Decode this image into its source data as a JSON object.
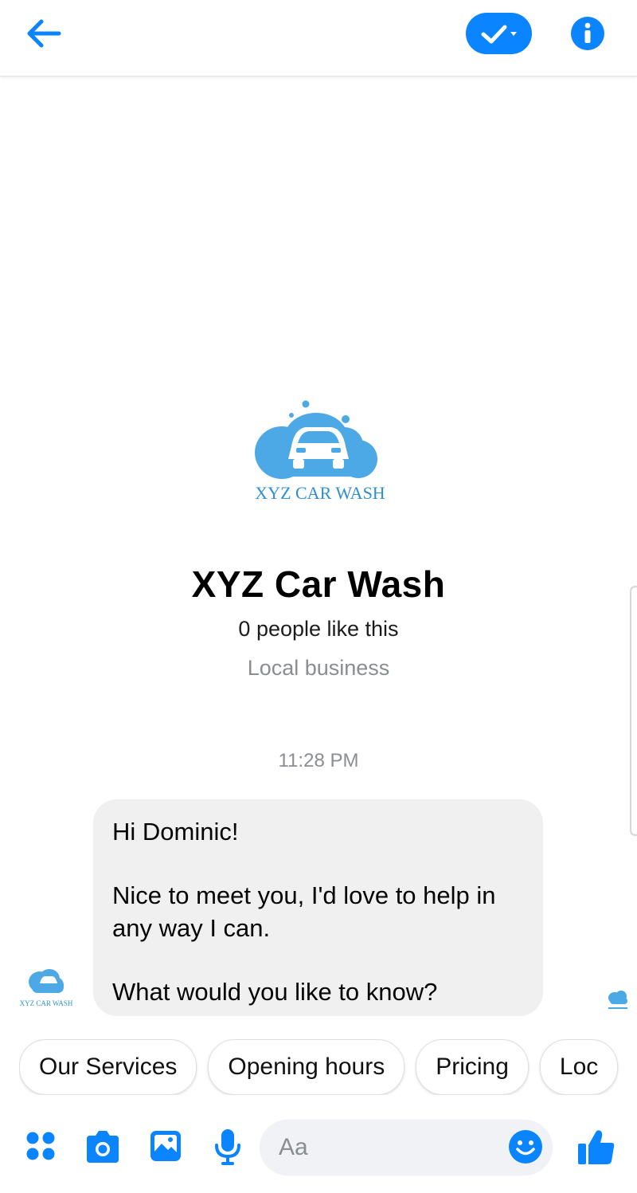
{
  "header": {
    "back_icon": "arrow-left-icon",
    "status_icon": "check-dropdown-icon",
    "info_icon": "info-icon",
    "accent": "#0a84ff"
  },
  "profile": {
    "logo_text": "XYZ CAR WASH",
    "name": "XYZ Car Wash",
    "likes": "0 people like this",
    "category": "Local business"
  },
  "conversation": {
    "timestamp": "11:28 PM",
    "message": {
      "line1": "Hi Dominic!",
      "line2": "Nice to meet you, I'd love to help in any way I can.",
      "line3": "What would you like to know?"
    },
    "avatar_logo_text": "XYZ CAR WASH",
    "bubble_color": "#f1f0f0"
  },
  "quick_replies": [
    "Our Services",
    "Opening hours",
    "Pricing",
    "Loc"
  ],
  "composer": {
    "placeholder": "Aa",
    "icons": [
      "grid-icon",
      "camera-icon",
      "gallery-icon",
      "microphone-icon",
      "emoji-icon",
      "thumbs-up-icon"
    ]
  }
}
